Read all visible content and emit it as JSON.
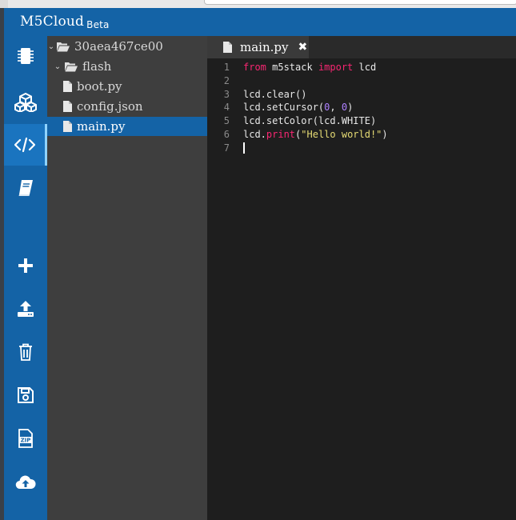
{
  "app": {
    "name": "M5Cloud",
    "badge": "Beta"
  },
  "sidebar": {
    "icons": [
      {
        "name": "device-icon"
      },
      {
        "name": "blocks-icon"
      },
      {
        "name": "code-icon",
        "active": true
      },
      {
        "name": "docs-icon"
      },
      {
        "name": "add-icon"
      },
      {
        "name": "upload-icon"
      },
      {
        "name": "trash-icon"
      },
      {
        "name": "save-icon"
      },
      {
        "name": "zip-icon"
      },
      {
        "name": "cloud-upload-icon"
      }
    ]
  },
  "tree": {
    "root": "30aea467ce00",
    "folder": "flash",
    "files": [
      "boot.py",
      "config.json",
      "main.py"
    ],
    "selected": "main.py"
  },
  "editor": {
    "tab": "main.py",
    "line_numbers": [
      "1",
      "2",
      "3",
      "4",
      "5",
      "6",
      "7"
    ],
    "lines": {
      "l1": {
        "kw1": "from",
        "mod": " m5stack ",
        "kw2": "import",
        "name": " lcd"
      },
      "l3": {
        "text": "lcd.clear()"
      },
      "l4": {
        "pre": "lcd.setCursor(",
        "n1": "0",
        "sep": ", ",
        "n2": "0",
        "post": ")"
      },
      "l5": {
        "text": "lcd.setColor(lcd.WHITE)"
      },
      "l6": {
        "pre": "lcd.",
        "fn": "print",
        "open": "(",
        "str": "\"Hello world!\"",
        "close": ")"
      }
    }
  },
  "colors": {
    "brand_blue": "#1463a6",
    "tree_bg": "#3e3e3e",
    "editor_bg": "#1e1e1e",
    "keyword": "#f92672",
    "number": "#ae81ff",
    "string": "#e6db74"
  }
}
